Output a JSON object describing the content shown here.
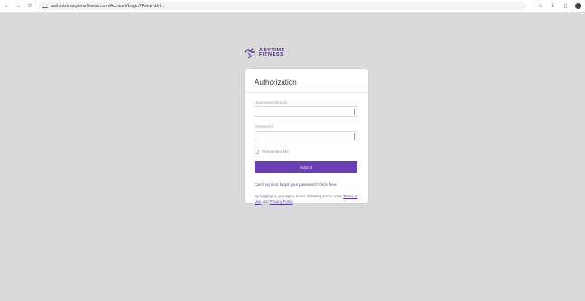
{
  "browser": {
    "url": "authorize.anytimefitness.com/Account/Login?ReturnUrl...",
    "back": "←",
    "forward": "→",
    "reload": "⟳",
    "star": "☆",
    "download": "⤓",
    "sidepanel": "▯"
  },
  "brand": {
    "line1": "ANYTIME",
    "line2": "FITNESS",
    "color": "#4a2b7d"
  },
  "form": {
    "title": "Authorization",
    "username_label": "Username (Email)",
    "password_label": "Password",
    "remember_label": "Remember Me",
    "submit_label": "Submit",
    "reset_link": "Can't log in or forgot your password? Click here.",
    "terms_prefix": "By logging in, you agree to the following terms: View ",
    "terms_link": "Terms of Use",
    "terms_and": " and ",
    "privacy_link": "Privacy Policy",
    "terms_suffix": "."
  },
  "colors": {
    "accent": "#6a3fb5",
    "background": "#dadada"
  }
}
